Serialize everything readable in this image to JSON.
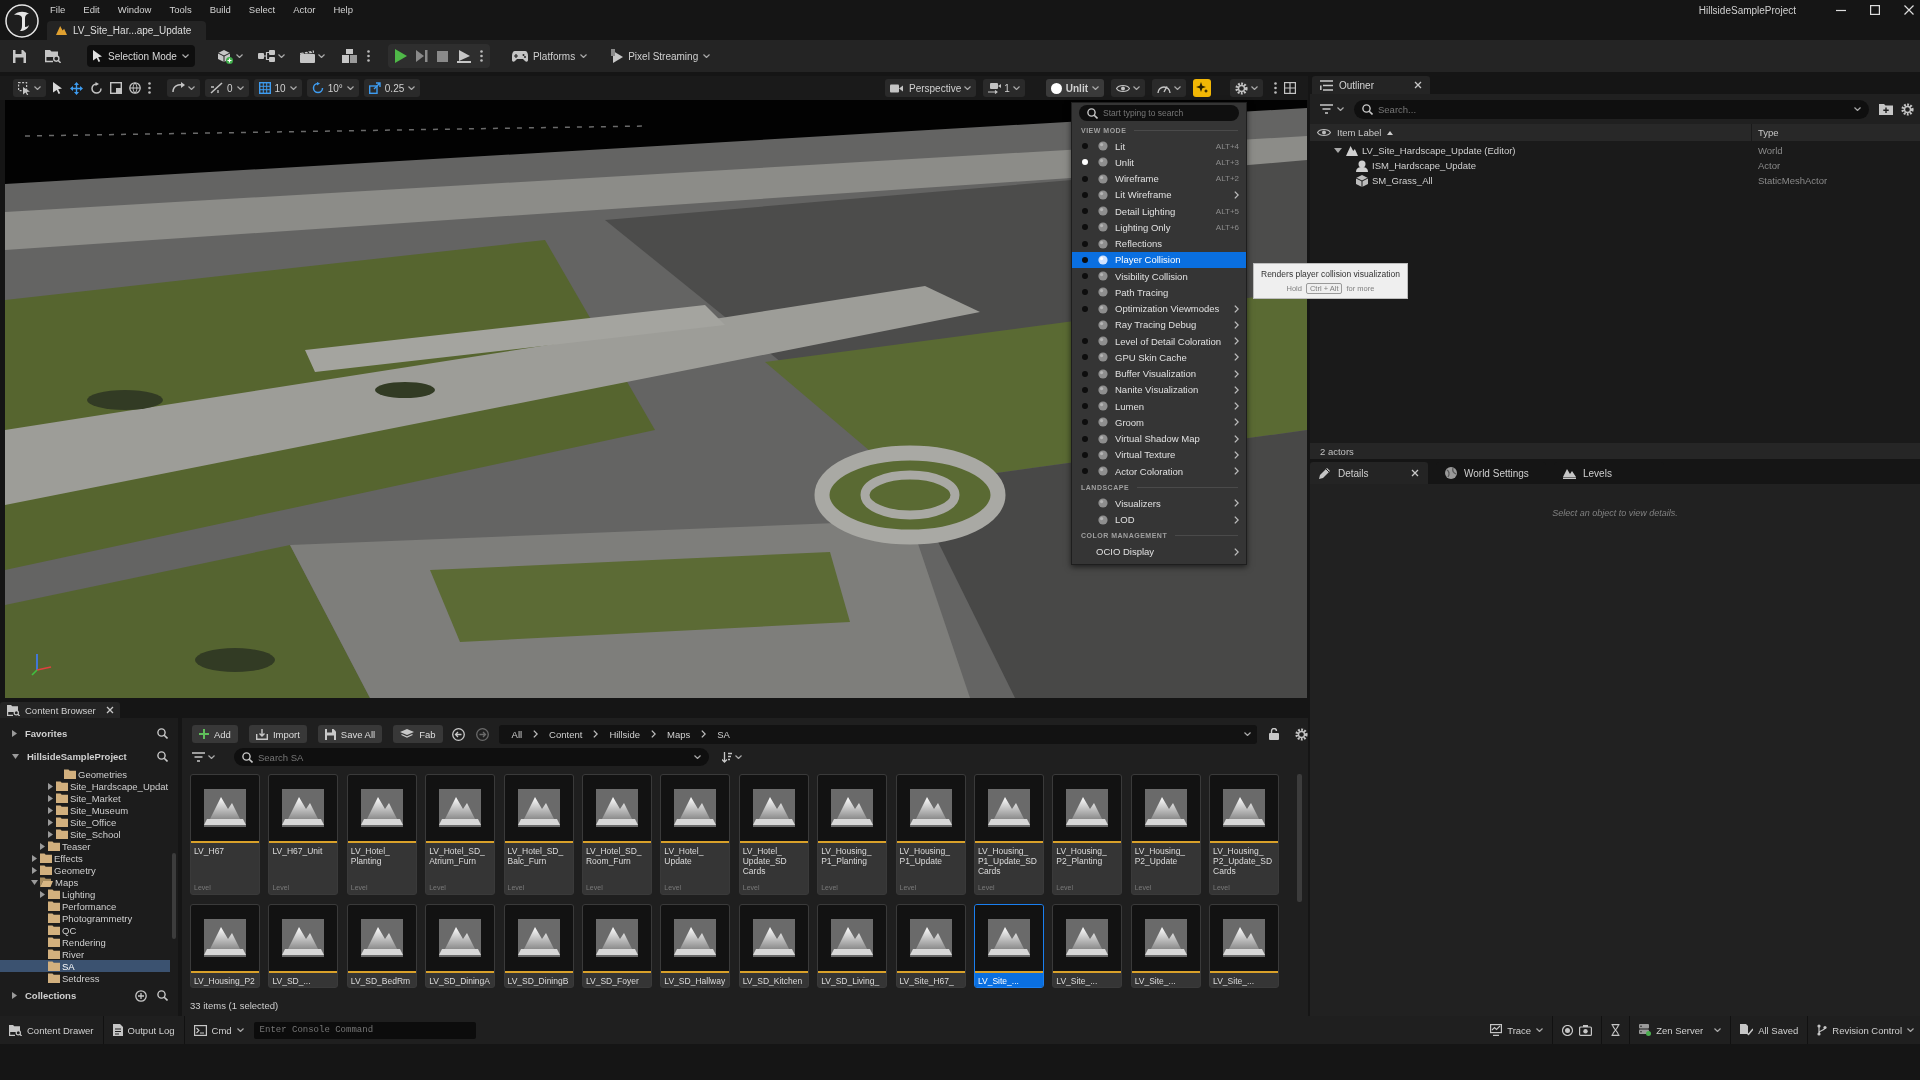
{
  "title_bar": {
    "menus": [
      "File",
      "Edit",
      "Window",
      "Tools",
      "Build",
      "Select",
      "Actor",
      "Help"
    ],
    "document_tab": "LV_Site_Har...ape_Update",
    "project": "HillsideSampleProject"
  },
  "main_toolbar": {
    "mode_button": "Selection Mode",
    "platforms_button": "Platforms",
    "pixel_streaming_button": "Pixel Streaming"
  },
  "viewport_toolbar": {
    "snaps": [
      {
        "kind": "surface",
        "value": "0"
      },
      {
        "kind": "grid",
        "value": "10"
      },
      {
        "kind": "rotation",
        "value": "10°"
      },
      {
        "kind": "scale",
        "value": "0.25"
      }
    ],
    "projection": "Perspective",
    "camera_speed": "1",
    "view_mode": "Unlit",
    "effects_toggle": {
      "on": true
    }
  },
  "view_mode_menu": {
    "search": {
      "placeholder": "Start typing to search"
    },
    "sections": [
      {
        "heading": "VIEW MODE",
        "items": [
          {
            "label": "Lit",
            "kind": "radio",
            "shortcut": "ALT+4",
            "submenu": false,
            "selected": false,
            "highlighted": false
          },
          {
            "label": "Unlit",
            "kind": "radio",
            "shortcut": "ALT+3",
            "submenu": false,
            "selected": true,
            "highlighted": false
          },
          {
            "label": "Wireframe",
            "kind": "radio",
            "shortcut": "ALT+2",
            "submenu": false,
            "selected": false,
            "highlighted": false
          },
          {
            "label": "Lit Wireframe",
            "kind": "radio",
            "submenu": true,
            "selected": false,
            "highlighted": false
          },
          {
            "label": "Detail Lighting",
            "kind": "radio",
            "shortcut": "ALT+5",
            "submenu": false,
            "selected": false,
            "highlighted": false
          },
          {
            "label": "Lighting Only",
            "kind": "radio",
            "shortcut": "ALT+6",
            "submenu": false,
            "selected": false,
            "highlighted": false
          },
          {
            "label": "Reflections",
            "kind": "radio",
            "submenu": false,
            "selected": false,
            "highlighted": false
          },
          {
            "label": "Player Collision",
            "kind": "radio",
            "submenu": false,
            "selected": false,
            "highlighted": true
          },
          {
            "label": "Visibility Collision",
            "kind": "radio",
            "submenu": false,
            "selected": false,
            "highlighted": false
          },
          {
            "label": "Path Tracing",
            "kind": "radio",
            "submenu": false,
            "selected": false,
            "highlighted": false
          },
          {
            "label": "Optimization Viewmodes",
            "kind": "radio",
            "submenu": true,
            "selected": false,
            "highlighted": false
          },
          {
            "label": "Ray Tracing Debug",
            "kind": "option",
            "submenu": true,
            "selected": false,
            "highlighted": false
          },
          {
            "label": "Level of Detail Coloration",
            "kind": "radio",
            "submenu": true,
            "selected": false,
            "highlighted": false
          },
          {
            "label": "GPU Skin Cache",
            "kind": "radio",
            "submenu": true,
            "selected": false,
            "highlighted": false
          },
          {
            "label": "Buffer Visualization",
            "kind": "radio",
            "submenu": true,
            "selected": false,
            "highlighted": false
          },
          {
            "label": "Nanite Visualization",
            "kind": "radio",
            "submenu": true,
            "selected": false,
            "highlighted": false
          },
          {
            "label": "Lumen",
            "kind": "radio",
            "submenu": true,
            "selected": false,
            "highlighted": false
          },
          {
            "label": "Groom",
            "kind": "radio",
            "submenu": true,
            "selected": false,
            "highlighted": false
          },
          {
            "label": "Virtual Shadow Map",
            "kind": "radio",
            "submenu": true,
            "selected": false,
            "highlighted": false
          },
          {
            "label": "Virtual Texture",
            "kind": "radio",
            "submenu": true,
            "selected": false,
            "highlighted": false
          },
          {
            "label": "Actor Coloration",
            "kind": "radio",
            "submenu": true,
            "selected": false,
            "highlighted": false
          }
        ]
      },
      {
        "heading": "LANDSCAPE",
        "items": [
          {
            "label": "Visualizers",
            "kind": "option",
            "submenu": true,
            "selected": false,
            "highlighted": false
          },
          {
            "label": "LOD",
            "kind": "option",
            "submenu": true,
            "selected": false,
            "highlighted": false
          }
        ]
      },
      {
        "heading": "COLOR MANAGEMENT",
        "items": [
          {
            "label": "OCIO Display",
            "kind": "text",
            "submenu": true,
            "selected": false,
            "highlighted": false
          }
        ]
      }
    ]
  },
  "tooltip": {
    "text": "Renders player collision visualization",
    "hint_before": "Hold",
    "hint_keys": "Ctrl + Alt",
    "hint_after": "for more"
  },
  "outliner": {
    "tab": "Outliner",
    "search": {
      "placeholder": "Search..."
    },
    "columns": [
      "Item Label",
      "Type"
    ],
    "rows": [
      {
        "label": "LV_Site_Hardscape_Update (Editor)",
        "type": "World",
        "kind": "world",
        "expanded": true,
        "children": [
          {
            "label": "ISM_Hardscape_Update",
            "type": "Actor",
            "kind": "actor"
          },
          {
            "label": "SM_Grass_All",
            "type": "StaticMeshActor",
            "kind": "static_mesh"
          }
        ]
      }
    ],
    "status": "2 actors"
  },
  "details": {
    "tabs": [
      {
        "label": "Details",
        "selected": true
      },
      {
        "label": "World Settings",
        "selected": false
      },
      {
        "label": "Levels",
        "selected": false
      }
    ],
    "empty_message": "Select an object to view details."
  },
  "content_browser": {
    "tab": "Content Browser",
    "sidebar": {
      "favorites": "Favorites",
      "project": "HillsideSampleProject",
      "folders": [
        {
          "children": [
            {
              "children": [
                {
                  "children": [
                    {
                      "label": "Geometries",
                      "expandable": false,
                      "expanded": false,
                      "selected": false
                    }
                  ]
                },
                {
                  "label": "Site_Hardscape_Updat",
                  "expandable": true,
                  "expanded": false,
                  "selected": false
                },
                {
                  "label": "Site_Market",
                  "expandable": true,
                  "expanded": false,
                  "selected": false
                },
                {
                  "label": "Site_Museum",
                  "expandable": true,
                  "expanded": false,
                  "selected": false
                },
                {
                  "label": "Site_Office",
                  "expandable": true,
                  "expanded": false,
                  "selected": false
                },
                {
                  "label": "Site_School",
                  "expandable": true,
                  "expanded": false,
                  "selected": false
                }
              ]
            },
            {
              "label": "Teaser",
              "expandable": true,
              "expanded": false,
              "selected": false
            }
          ]
        },
        {
          "label": "Effects",
          "expandable": true,
          "expanded": false,
          "selected": false
        },
        {
          "label": "Geometry",
          "expandable": true,
          "expanded": false,
          "selected": false
        },
        {
          "label": "Maps",
          "expandable": true,
          "expanded": true,
          "selected": false,
          "children": [
            {
              "label": "Lighting",
              "expandable": true,
              "expanded": false,
              "selected": false
            },
            {
              "label": "Performance",
              "expandable": false,
              "expanded": false,
              "selected": false
            },
            {
              "label": "Photogrammetry",
              "expandable": false,
              "expanded": false,
              "selected": false
            },
            {
              "label": "QC",
              "expandable": false,
              "expanded": false,
              "selected": false
            },
            {
              "label": "Rendering",
              "expandable": false,
              "expanded": false,
              "selected": false
            },
            {
              "label": "River",
              "expandable": false,
              "expanded": false,
              "selected": false
            },
            {
              "label": "SA",
              "expandable": false,
              "expanded": false,
              "selected": true
            },
            {
              "label": "Setdress",
              "expandable": false,
              "expanded": false,
              "selected": false
            }
          ]
        }
      ],
      "collections": "Collections"
    },
    "toolbar": [
      {
        "kind": "add",
        "label": "Add"
      },
      {
        "kind": "import",
        "label": "Import"
      },
      {
        "kind": "save",
        "label": "Save All"
      },
      {
        "kind": "fab",
        "label": "Fab"
      }
    ],
    "breadcrumbs": [
      "All",
      "Content",
      "Hillside",
      "Maps",
      "SA"
    ],
    "search": {
      "placeholder": "Search SA"
    },
    "assets": [
      {
        "name": "LV_H67",
        "type": "Level",
        "selected": false
      },
      {
        "name": "LV_H67_Unit",
        "type": "Level",
        "selected": false
      },
      {
        "name": "LV_Hotel_Planting",
        "type": "Level",
        "selected": false
      },
      {
        "name": "LV_Hotel_SD_Atrium_Furn",
        "type": "Level",
        "selected": false
      },
      {
        "name": "LV_Hotel_SD_Balc_Furn",
        "type": "Level",
        "selected": false
      },
      {
        "name": "LV_Hotel_SD_Room_Furn",
        "type": "Level",
        "selected": false
      },
      {
        "name": "LV_Hotel_Update",
        "type": "Level",
        "selected": false
      },
      {
        "name": "LV_Hotel_Update_SD Cards",
        "type": "Level",
        "selected": false
      },
      {
        "name": "LV_Housing_P1_Planting",
        "type": "Level",
        "selected": false
      },
      {
        "name": "LV_Housing_P1_Update",
        "type": "Level",
        "selected": false
      },
      {
        "name": "LV_Housing_P1_Update_SD Cards",
        "type": "Level",
        "selected": false
      },
      {
        "name": "LV_Housing_P2_Planting",
        "type": "Level",
        "selected": false
      },
      {
        "name": "LV_Housing_P2_Update",
        "type": "Level",
        "selected": false
      },
      {
        "name": "LV_Housing_P2_Update_SD Cards",
        "type": "Level",
        "selected": false
      },
      {
        "name": "LV_Housing_P2",
        "selected": false
      },
      {
        "name": "LV_SD_...",
        "selected": false
      },
      {
        "name": "LV_SD_BedRm",
        "selected": false
      },
      {
        "name": "LV_SD_DiningA",
        "selected": false
      },
      {
        "name": "LV_SD_DiningB",
        "selected": false
      },
      {
        "name": "LV_SD_Foyer",
        "selected": false
      },
      {
        "name": "LV_SD_Hallway",
        "selected": false
      },
      {
        "name": "LV_SD_Kitchen",
        "selected": false
      },
      {
        "name": "LV_SD_Living_",
        "selected": false
      },
      {
        "name": "LV_Site_H67_",
        "selected": false
      },
      {
        "name": "LV_Site_...",
        "selected": true
      },
      {
        "name": "LV_Site_...",
        "selected": false
      },
      {
        "name": "LV_Site_...",
        "selected": false
      },
      {
        "name": "LV_Site_...",
        "selected": false
      }
    ],
    "status": "33 items (1 selected)"
  },
  "status_bar": {
    "content_drawer": "Content Drawer",
    "output_log": "Output Log",
    "cmd": "Cmd",
    "console": {
      "placeholder": "Enter Console Command"
    },
    "trace": "Trace",
    "zen_server": "Zen Server",
    "save_state": "All Saved",
    "revision_control": "Revision Control"
  }
}
